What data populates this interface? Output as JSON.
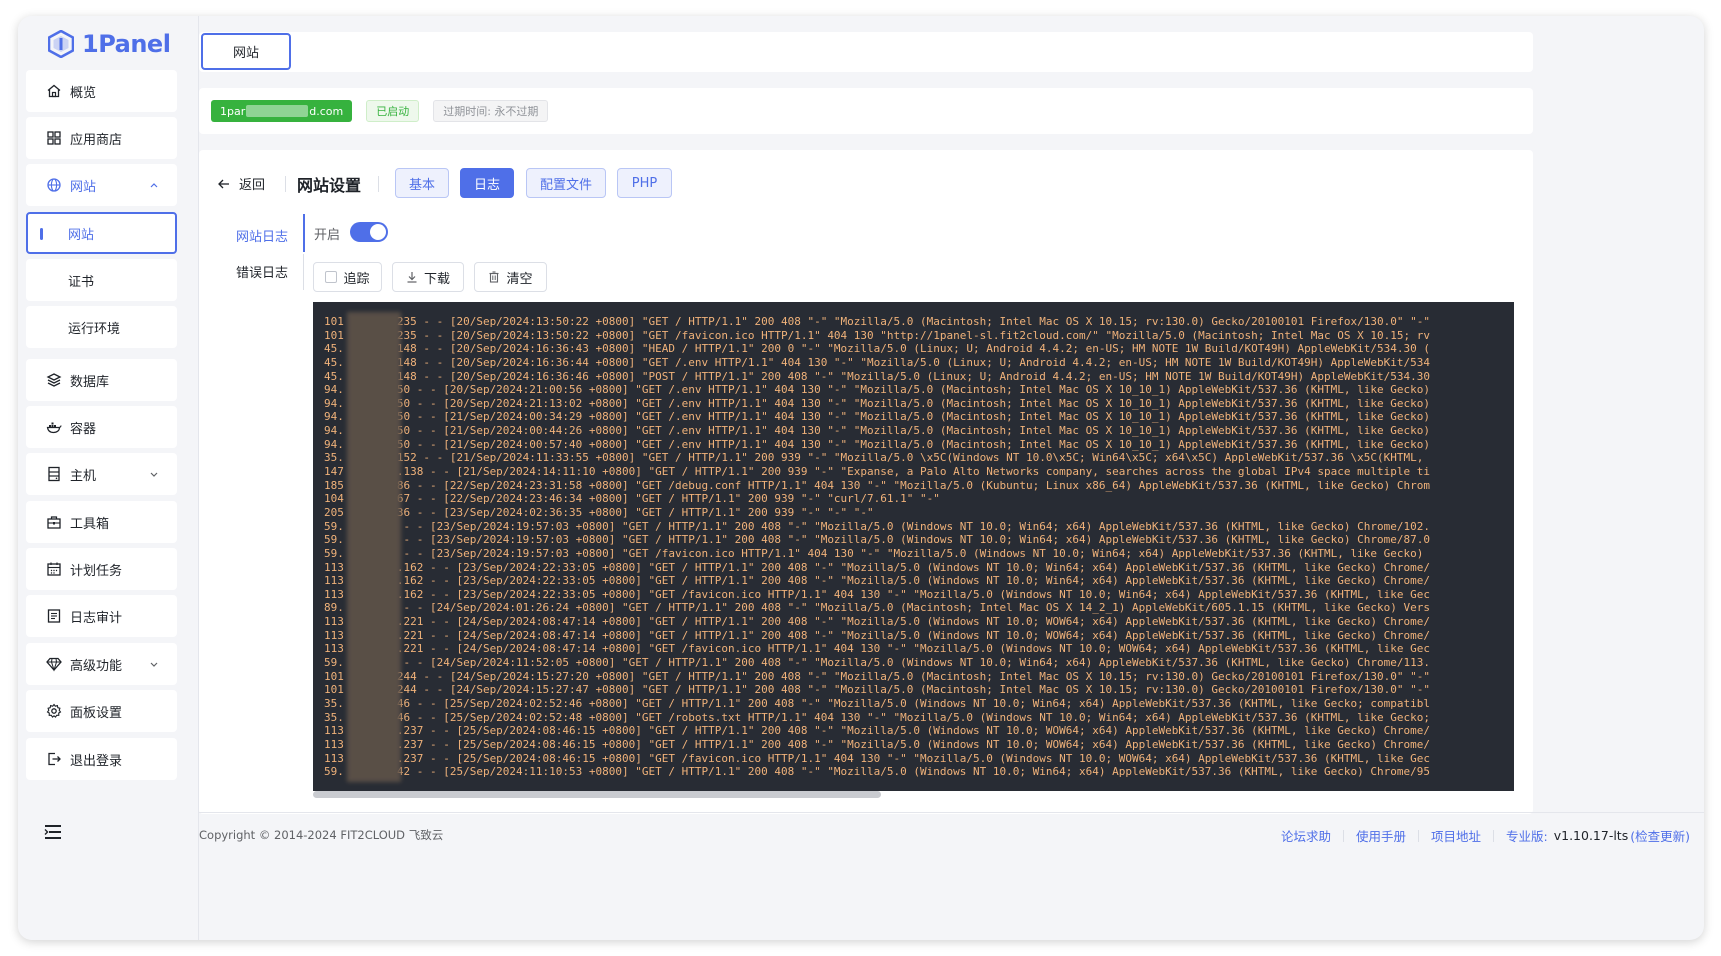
{
  "app": {
    "logo_text": "1Panel"
  },
  "sidebar": {
    "items": [
      {
        "label": "概览",
        "icon": "home-icon"
      },
      {
        "label": "应用商店",
        "icon": "grid-icon"
      },
      {
        "label": "网站",
        "icon": "globe-icon",
        "expanded": true
      },
      {
        "label": "数据库",
        "icon": "layers-icon"
      },
      {
        "label": "容器",
        "icon": "docker-icon"
      },
      {
        "label": "主机",
        "icon": "server-icon",
        "has_chevron": true
      },
      {
        "label": "工具箱",
        "icon": "toolbox-icon"
      },
      {
        "label": "计划任务",
        "icon": "calendar-icon"
      },
      {
        "label": "日志审计",
        "icon": "log-icon"
      },
      {
        "label": "高级功能",
        "icon": "diamond-icon",
        "has_chevron": true
      },
      {
        "label": "面板设置",
        "icon": "gear-icon"
      },
      {
        "label": "退出登录",
        "icon": "logout-icon"
      }
    ],
    "subitems": [
      {
        "label": "网站",
        "active": true
      },
      {
        "label": "证书"
      },
      {
        "label": "运行环境"
      }
    ]
  },
  "tabbar": {
    "tab_label": "网站"
  },
  "info": {
    "domain_prefix": "1par",
    "domain_suffix": "d.com",
    "status": "已启动",
    "expire": "过期时间: 永不过期"
  },
  "settings": {
    "back_label": "返回",
    "title": "网站设置",
    "tabs": [
      "基本",
      "日志",
      "配置文件",
      "PHP"
    ],
    "active_tab": "日志",
    "log_tabs": [
      "网站日志",
      "错误日志"
    ],
    "switch_label": "开启",
    "switch_on": true,
    "tools": [
      "追踪",
      "下载",
      "清空"
    ]
  },
  "log_lines": [
    "101        235 - - [20/Sep/2024:13:50:22 +0800] \"GET / HTTP/1.1\" 200 408 \"-\" \"Mozilla/5.0 (Macintosh; Intel Mac OS X 10.15; rv:130.0) Gecko/20100101 Firefox/130.0\" \"-\"",
    "101        235 - - [20/Sep/2024:13:50:22 +0800] \"GET /favicon.ico HTTP/1.1\" 404 130 \"http://1panel-sl.fit2cloud.com/\" \"Mozilla/5.0 (Macintosh; Intel Mac OS X 10.15; rv",
    "45.        148 - - [20/Sep/2024:16:36:43 +0800] \"HEAD / HTTP/1.1\" 200 0 \"-\" \"Mozilla/5.0 (Linux; U; Android 4.4.2; en-US; HM NOTE 1W Build/KOT49H) AppleWebKit/534.30 (",
    "45.        148 - - [20/Sep/2024:16:36:44 +0800] \"GET /.env HTTP/1.1\" 404 130 \"-\" \"Mozilla/5.0 (Linux; U; Android 4.4.2; en-US; HM NOTE 1W Build/KOT49H) AppleWebKit/534",
    "45.        148 - - [20/Sep/2024:16:36:46 +0800] \"POST / HTTP/1.1\" 200 408 \"-\" \"Mozilla/5.0 (Linux; U; Android 4.4.2; en-US; HM NOTE 1W Build/KOT49H) AppleWebKit/534.30",
    "94.        50 - - [20/Sep/2024:21:00:56 +0800] \"GET /.env HTTP/1.1\" 404 130 \"-\" \"Mozilla/5.0 (Macintosh; Intel Mac OS X 10_10_1) AppleWebKit/537.36 (KHTML, like Gecko)",
    "94.        50 - - [20/Sep/2024:21:13:02 +0800] \"GET /.env HTTP/1.1\" 404 130 \"-\" \"Mozilla/5.0 (Macintosh; Intel Mac OS X 10_10_1) AppleWebKit/537.36 (KHTML, like Gecko)",
    "94.        50 - - [21/Sep/2024:00:34:29 +0800] \"GET /.env HTTP/1.1\" 404 130 \"-\" \"Mozilla/5.0 (Macintosh; Intel Mac OS X 10_10_1) AppleWebKit/537.36 (KHTML, like Gecko)",
    "94.        50 - - [21/Sep/2024:00:44:26 +0800] \"GET /.env HTTP/1.1\" 404 130 \"-\" \"Mozilla/5.0 (Macintosh; Intel Mac OS X 10_10_1) AppleWebKit/537.36 (KHTML, like Gecko)",
    "94.        50 - - [21/Sep/2024:00:57:40 +0800] \"GET /.env HTTP/1.1\" 404 130 \"-\" \"Mozilla/5.0 (Macintosh; Intel Mac OS X 10_10_1) AppleWebKit/537.36 (KHTML, like Gecko)",
    "35.        152 - - [21/Sep/2024:11:33:55 +0800] \"GET / HTTP/1.1\" 200 939 \"-\" \"Mozilla/5.0 \\x5C(Windows NT 10.0\\x5C; Win64\\x5C; x64\\x5C) AppleWebKit/537.36 \\x5C(KHTML,",
    "147        .138 - - [21/Sep/2024:14:11:10 +0800] \"GET / HTTP/1.1\" 200 939 \"-\" \"Expanse, a Palo Alto Networks company, searches across the global IPv4 space multiple ti",
    "185        86 - - [22/Sep/2024:23:31:58 +0800] \"GET /debug.conf HTTP/1.1\" 404 130 \"-\" \"Mozilla/5.0 (Kubuntu; Linux x86_64) AppleWebKit/537.36 (KHTML, like Gecko) Chrom",
    "104        67 - - [22/Sep/2024:23:46:34 +0800] \"GET / HTTP/1.1\" 200 939 \"-\" \"curl/7.61.1\" \"-\"",
    "205        36 - - [23/Sep/2024:02:36:35 +0800] \"GET / HTTP/1.1\" 200 939 \"-\" \"-\" \"-\"",
    "59.         - - [23/Sep/2024:19:57:03 +0800] \"GET / HTTP/1.1\" 200 408 \"-\" \"Mozilla/5.0 (Windows NT 10.0; Win64; x64) AppleWebKit/537.36 (KHTML, like Gecko) Chrome/102.",
    "59.         - - [23/Sep/2024:19:57:03 +0800] \"GET / HTTP/1.1\" 200 408 \"-\" \"Mozilla/5.0 (Windows NT 10.0; Win64; x64) AppleWebKit/537.36 (KHTML, like Gecko) Chrome/87.0",
    "59.         - - [23/Sep/2024:19:57:03 +0800] \"GET /favicon.ico HTTP/1.1\" 404 130 \"-\" \"Mozilla/5.0 (Windows NT 10.0; Win64; x64) AppleWebKit/537.36 (KHTML, like Gecko) ",
    "113        .162 - - [23/Sep/2024:22:33:05 +0800] \"GET / HTTP/1.1\" 200 408 \"-\" \"Mozilla/5.0 (Windows NT 10.0; Win64; x64) AppleWebKit/537.36 (KHTML, like Gecko) Chrome/",
    "113        .162 - - [23/Sep/2024:22:33:05 +0800] \"GET / HTTP/1.1\" 200 408 \"-\" \"Mozilla/5.0 (Windows NT 10.0; Win64; x64) AppleWebKit/537.36 (KHTML, like Gecko) Chrome/",
    "113        .162 - - [23/Sep/2024:22:33:05 +0800] \"GET /favicon.ico HTTP/1.1\" 404 130 \"-\" \"Mozilla/5.0 (Windows NT 10.0; Win64; x64) AppleWebKit/537.36 (KHTML, like Gec",
    "89.         - - [24/Sep/2024:01:26:24 +0800] \"GET / HTTP/1.1\" 200 408 \"-\" \"Mozilla/5.0 (Macintosh; Intel Mac OS X 14_2_1) AppleWebKit/605.1.15 (KHTML, like Gecko) Vers",
    "113        .221 - - [24/Sep/2024:08:47:14 +0800] \"GET / HTTP/1.1\" 200 408 \"-\" \"Mozilla/5.0 (Windows NT 10.0; WOW64; x64) AppleWebKit/537.36 (KHTML, like Gecko) Chrome/",
    "113        .221 - - [24/Sep/2024:08:47:14 +0800] \"GET / HTTP/1.1\" 200 408 \"-\" \"Mozilla/5.0 (Windows NT 10.0; WOW64; x64) AppleWebKit/537.36 (KHTML, like Gecko) Chrome/",
    "113        .221 - - [24/Sep/2024:08:47:14 +0800] \"GET /favicon.ico HTTP/1.1\" 404 130 \"-\" \"Mozilla/5.0 (Windows NT 10.0; WOW64; x64) AppleWebKit/537.36 (KHTML, like Gec",
    "59.         - - [24/Sep/2024:11:52:05 +0800] \"GET / HTTP/1.1\" 200 408 \"-\" \"Mozilla/5.0 (Windows NT 10.0; Win64; x64) AppleWebKit/537.36 (KHTML, like Gecko) Chrome/113.",
    "101        244 - - [24/Sep/2024:15:27:20 +0800] \"GET / HTTP/1.1\" 200 408 \"-\" \"Mozilla/5.0 (Macintosh; Intel Mac OS X 10.15; rv:130.0) Gecko/20100101 Firefox/130.0\" \"-\"",
    "101        244 - - [24/Sep/2024:15:27:47 +0800] \"GET / HTTP/1.1\" 200 408 \"-\" \"Mozilla/5.0 (Macintosh; Intel Mac OS X 10.15; rv:130.0) Gecko/20100101 Firefox/130.0\" \"-\"",
    "35.        46 - - [25/Sep/2024:02:52:46 +0800] \"GET / HTTP/1.1\" 200 408 \"-\" \"Mozilla/5.0 (Windows NT 10.0; Win64; x64) AppleWebKit/537.36 (KHTML, like Gecko; compatibl",
    "35.        46 - - [25/Sep/2024:02:52:48 +0800] \"GET /robots.txt HTTP/1.1\" 404 130 \"-\" \"Mozilla/5.0 (Windows NT 10.0; Win64; x64) AppleWebKit/537.36 (KHTML, like Gecko;",
    "113        .237 - - [25/Sep/2024:08:46:15 +0800] \"GET / HTTP/1.1\" 200 408 \"-\" \"Mozilla/5.0 (Windows NT 10.0; WOW64; x64) AppleWebKit/537.36 (KHTML, like Gecko) Chrome/",
    "113        .237 - - [25/Sep/2024:08:46:15 +0800] \"GET / HTTP/1.1\" 200 408 \"-\" \"Mozilla/5.0 (Windows NT 10.0; WOW64; x64) AppleWebKit/537.36 (KHTML, like Gecko) Chrome/",
    "113        .237 - - [25/Sep/2024:08:46:15 +0800] \"GET /favicon.ico HTTP/1.1\" 404 130 \"-\" \"Mozilla/5.0 (Windows NT 10.0; WOW64; x64) AppleWebKit/537.36 (KHTML, like Gec",
    "59.        42 - - [25/Sep/2024:11:10:53 +0800] \"GET / HTTP/1.1\" 200 408 \"-\" \"Mozilla/5.0 (Windows NT 10.0; Win64; x64) AppleWebKit/537.36 (KHTML, like Gecko) Chrome/95"
  ],
  "footer": {
    "copyright": "Copyright © 2014-2024 FIT2CLOUD 飞致云",
    "links": [
      "论坛求助",
      "使用手册",
      "项目地址"
    ],
    "edition_label": "专业版:",
    "version": "v1.10.17-lts",
    "check_update": "(检查更新)"
  },
  "colors": {
    "accent": "#4f6fe8",
    "success": "#36b23e",
    "log_bg": "#282c34",
    "log_text": "#f0b27a"
  }
}
